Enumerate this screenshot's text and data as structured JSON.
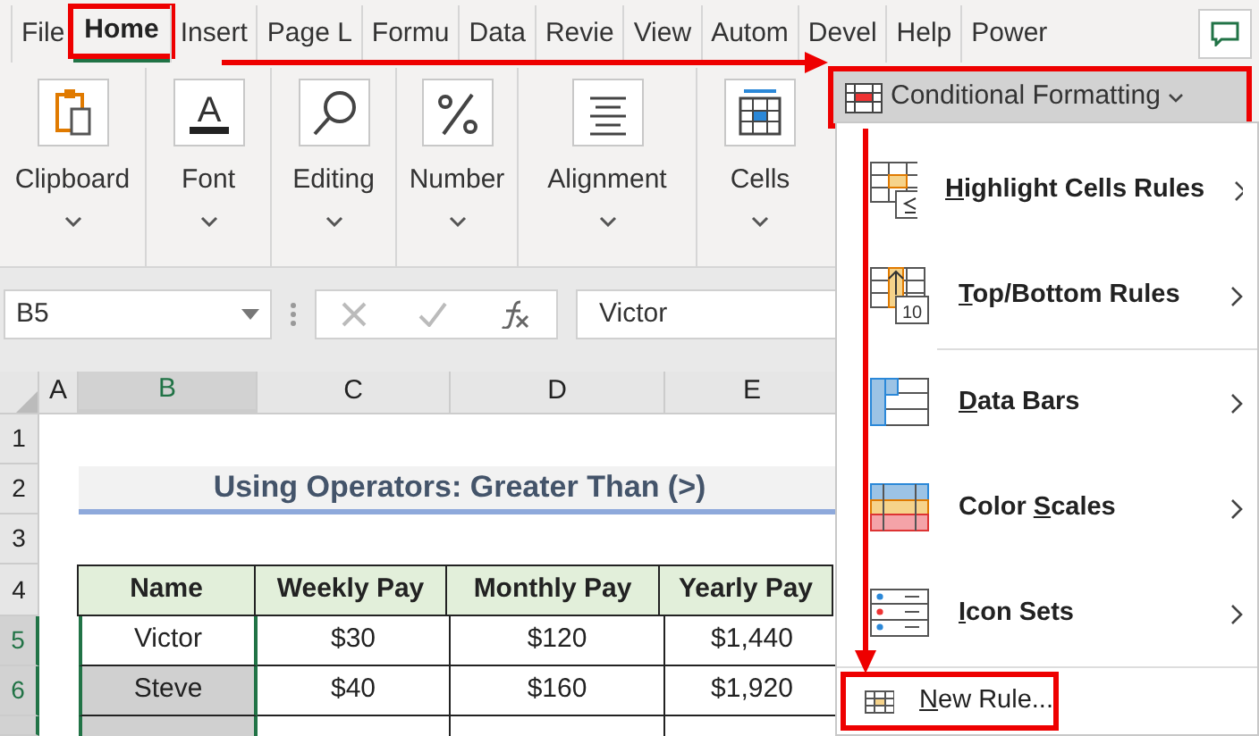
{
  "tabs": [
    {
      "label": "File",
      "selected": false,
      "annotated": false
    },
    {
      "label": "Home",
      "selected": true,
      "annotated": true
    },
    {
      "label": "Insert",
      "selected": false,
      "annotated": false
    },
    {
      "label": "Page L",
      "selected": false,
      "annotated": false
    },
    {
      "label": "Formu",
      "selected": false,
      "annotated": false
    },
    {
      "label": "Data",
      "selected": false,
      "annotated": false
    },
    {
      "label": "Revie",
      "selected": false,
      "annotated": false
    },
    {
      "label": "View",
      "selected": false,
      "annotated": false
    },
    {
      "label": "Autom",
      "selected": false,
      "annotated": false
    },
    {
      "label": "Devel",
      "selected": false,
      "annotated": false
    },
    {
      "label": "Help",
      "selected": false,
      "annotated": false
    },
    {
      "label": "Power",
      "selected": false,
      "annotated": false
    }
  ],
  "ribbon_groups": [
    {
      "kind": "clipboard",
      "label": "Clipboard"
    },
    {
      "kind": "font",
      "label": "Font",
      "icon_text": "A"
    },
    {
      "kind": "editing",
      "label": "Editing"
    },
    {
      "kind": "number",
      "label": "Number"
    },
    {
      "kind": "alignment",
      "label": "Alignment"
    },
    {
      "kind": "cells",
      "label": "Cells"
    }
  ],
  "name_box": "B5",
  "formula": "Victor",
  "columns": [
    {
      "label": "A",
      "selected": false
    },
    {
      "label": "B",
      "selected": true
    },
    {
      "label": "C",
      "selected": false
    },
    {
      "label": "D",
      "selected": false
    },
    {
      "label": "E",
      "selected": false
    }
  ],
  "row_numbers": [
    "1",
    "2",
    "3",
    "4"
  ],
  "title": "Using Operators: Greater Than (>)",
  "table": {
    "columns": [
      "Name",
      "Weekly Pay",
      "Monthly Pay",
      "Yearly Pay"
    ],
    "rows": [
      {
        "row": "5",
        "cells": [
          "Victor",
          "$30",
          "$120",
          "$1,440"
        ],
        "selected": true
      },
      {
        "row": "6",
        "cells": [
          "Steve",
          "$40",
          "$160",
          "$1,920"
        ],
        "selected": true
      }
    ]
  },
  "menu": {
    "button": "Conditional Formatting",
    "items": [
      {
        "kind": "highlight",
        "label": {
          "key": "H",
          "after": "ighlight Cells Rules"
        },
        "submenu": true
      },
      {
        "kind": "topbottom",
        "label": {
          "key": "T",
          "after": "op/Bottom Rules"
        },
        "icon_text": "10",
        "submenu": true
      },
      {
        "kind": "databars",
        "label": {
          "key": "D",
          "after": "ata Bars"
        },
        "submenu": true
      },
      {
        "kind": "colorscales",
        "label": {
          "before": "Color ",
          "key": "S",
          "after": "cales"
        },
        "submenu": true
      },
      {
        "kind": "iconsets",
        "label": {
          "key": "I",
          "after": "con Sets"
        },
        "submenu": true
      }
    ],
    "new_rule": {
      "key": "N",
      "after": "ew Rule..."
    }
  }
}
